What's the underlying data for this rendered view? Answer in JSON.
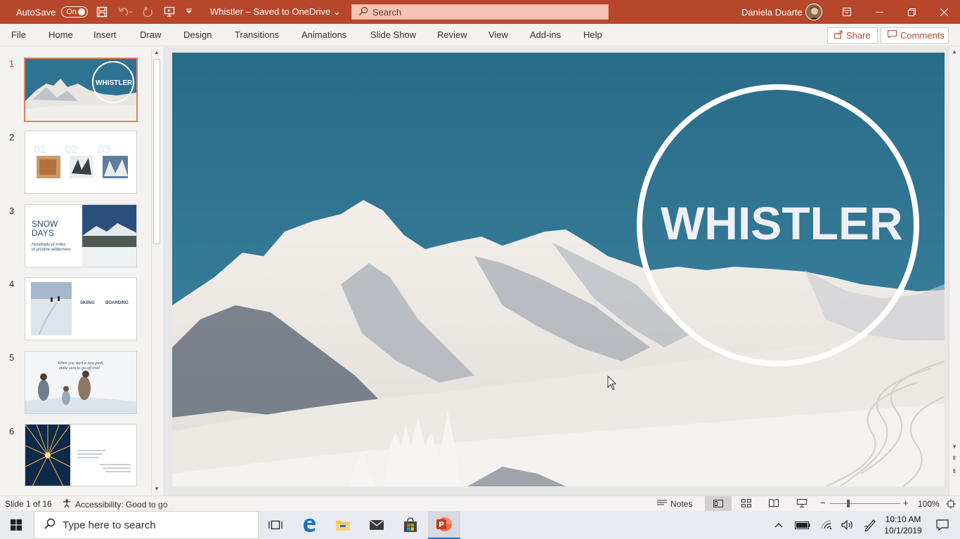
{
  "titlebar": {
    "autosave_label": "AutoSave",
    "autosave_state": "On",
    "doc_title": "Whistler – Saved to OneDrive",
    "search_placeholder": "Search",
    "user_name": "Daniela Duarte",
    "accent": "#b7472a"
  },
  "ribbon": {
    "tabs": [
      "File",
      "Home",
      "Insert",
      "Draw",
      "Design",
      "Transitions",
      "Animations",
      "Slide Show",
      "Review",
      "View",
      "Add-ins",
      "Help"
    ],
    "share_label": "Share",
    "comments_label": "Comments"
  },
  "thumbnails": {
    "numbers": [
      "1",
      "2",
      "3",
      "4",
      "5",
      "6"
    ],
    "t1_title": "WHISTLER",
    "t3_title_a": "SNOW",
    "t3_title_b": "DAYS",
    "t3_sub_a": "Hundreds of miles",
    "t3_sub_b": "of pristine wilderness",
    "t4_col1": "SKIING",
    "t4_col2": "BOARDING",
    "t5_quote_a": "When you start a new path,",
    "t5_quote_b": "make sure to go off-trail",
    "t2_numbers": [
      "01",
      "02",
      "03"
    ]
  },
  "slide": {
    "title": "WHISTLER"
  },
  "status": {
    "slide_info": "Slide 1 of 16",
    "accessibility": "Accessibility: Good to go",
    "notes_label": "Notes",
    "zoom": "100%"
  },
  "taskbar": {
    "search_placeholder": "Type here to search",
    "time": "10:10 AM",
    "date": "10/1/2019"
  },
  "icons": [
    "windows-logo-icon",
    "search-icon",
    "save-icon",
    "undo-icon",
    "redo-icon",
    "present-icon",
    "customize-qat-icon",
    "ribbon-display-icon",
    "minimize-icon",
    "restore-icon",
    "close-icon",
    "share-icon",
    "comment-icon",
    "accessibility-icon",
    "notes-icon",
    "normal-view-icon",
    "slide-sorter-icon",
    "reading-view-icon",
    "slideshow-icon",
    "fit-slide-icon",
    "task-view-icon",
    "edge-icon",
    "file-explorer-icon",
    "mail-icon",
    "store-icon",
    "powerpoint-icon",
    "chevron-up-icon",
    "battery-icon",
    "wifi-icon",
    "volume-icon",
    "pen-icon",
    "notifications-icon"
  ]
}
